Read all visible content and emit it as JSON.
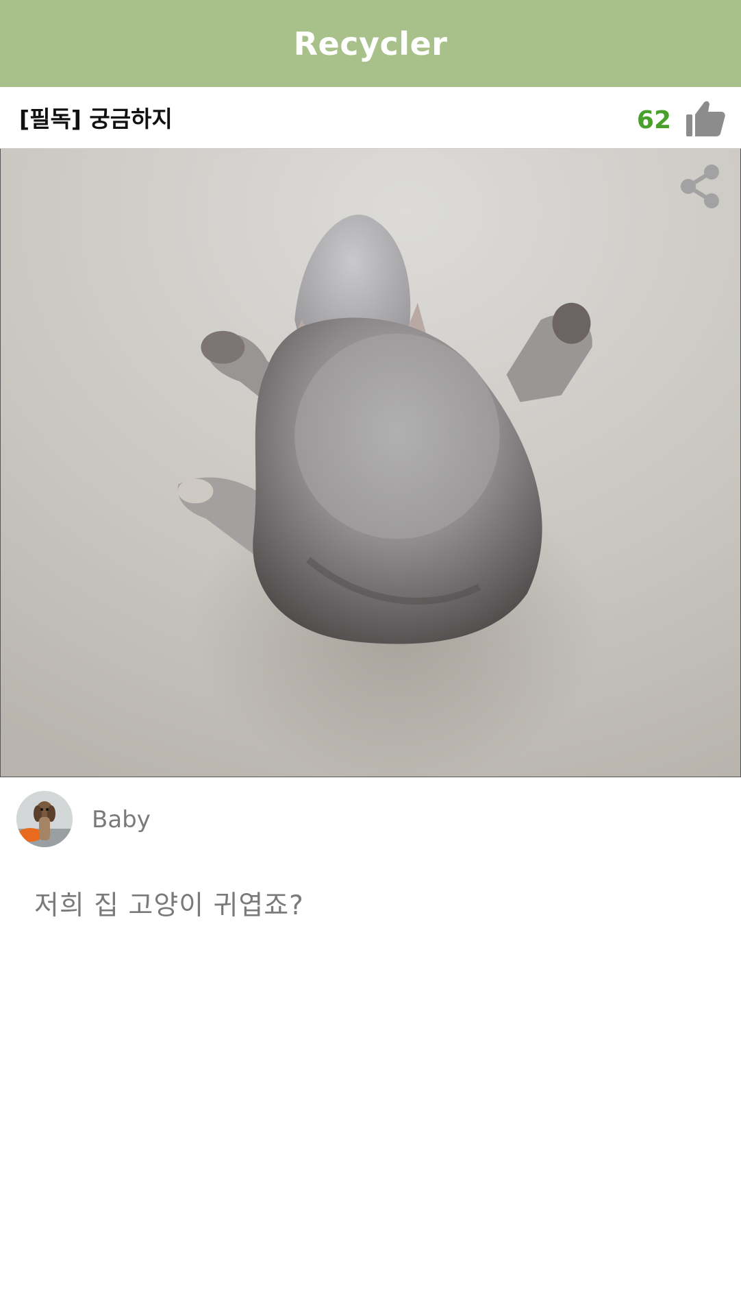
{
  "app_bar": {
    "title": "Recycler",
    "background": "#a8c18a",
    "title_color": "#ffffff"
  },
  "post": {
    "title": "[필독] 궁금하지",
    "like_count": "62",
    "like_count_color": "#4aa02c",
    "like_icon": "thumbs-up-icon",
    "share_icon": "share-icon",
    "image_subject": "cat-photo",
    "author": {
      "name": "Baby",
      "avatar": "dog-avatar"
    },
    "body": "저희 집 고양이 귀엽죠?"
  }
}
